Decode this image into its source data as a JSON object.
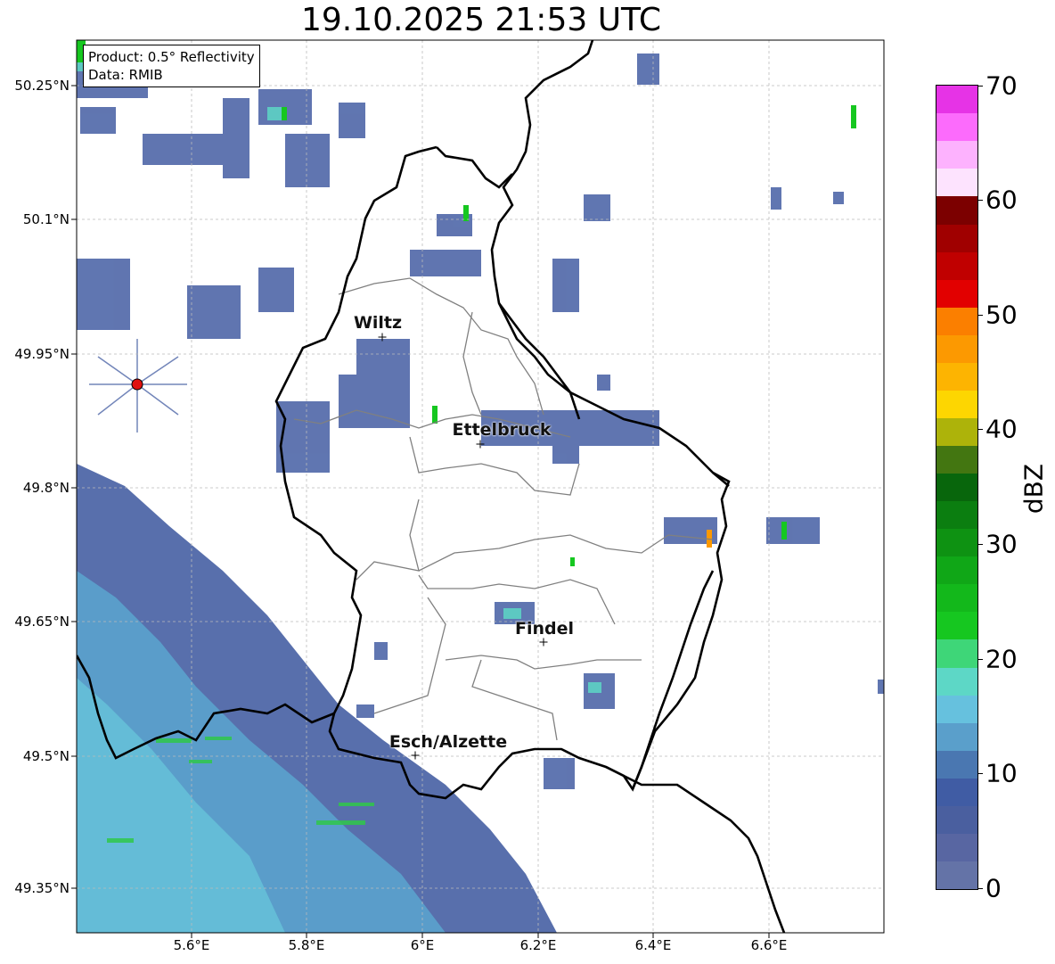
{
  "title": "19.10.2025 21:53 UTC",
  "info": {
    "product": "Product: 0.5° Reflectivity",
    "data": "Data: RMIB"
  },
  "lat_labels": [
    "50.25°N",
    "50.1°N",
    "49.95°N",
    "49.8°N",
    "49.65°N",
    "49.5°N",
    "49.35°N"
  ],
  "lon_labels": [
    "5.6°E",
    "5.8°E",
    "6°E",
    "6.2°E",
    "6.4°E",
    "6.6°E"
  ],
  "cities": [
    {
      "name": "Wiltz"
    },
    {
      "name": "Ettelbruck"
    },
    {
      "name": "Findel"
    },
    {
      "name": "Esch/Alzette"
    }
  ],
  "colorbar": {
    "label": "dBZ",
    "ticks": [
      "0",
      "10",
      "20",
      "30",
      "40",
      "50",
      "60",
      "70"
    ],
    "colors": [
      "#6473a7",
      "#5866a2",
      "#4a5f9f",
      "#405ca4",
      "#4a77b1",
      "#5a9fcb",
      "#66c1de",
      "#5dd7c6",
      "#3ed678",
      "#16c720",
      "#13b81b",
      "#10a717",
      "#0e9212",
      "#0b7e10",
      "#08660c",
      "#437611",
      "#adb30a",
      "#fdd601",
      "#fdb401",
      "#fc9901",
      "#fb7f00",
      "#e20000",
      "#c00000",
      "#a00000",
      "#7c0000",
      "#fde3fe",
      "#fdb2fe",
      "#fc6bfc",
      "#e633e6"
    ]
  },
  "radar_site_color": "#e01010"
}
